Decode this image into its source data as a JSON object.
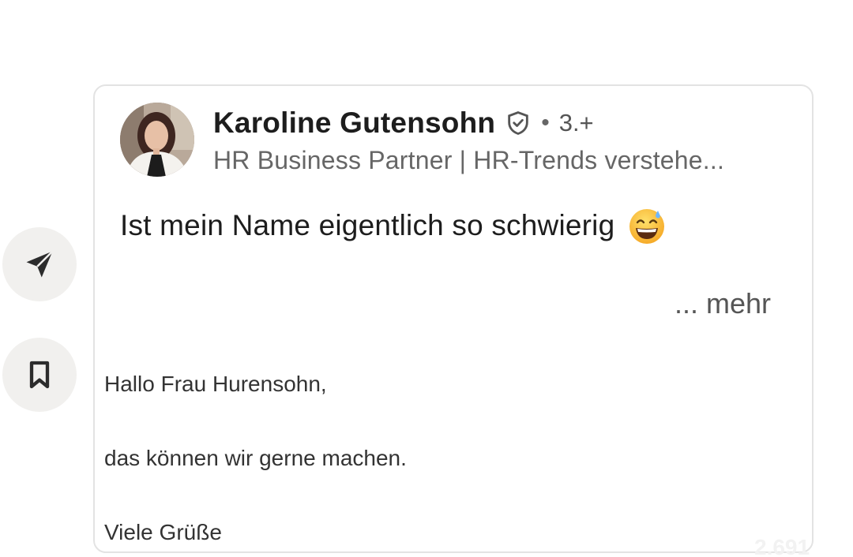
{
  "post": {
    "author": {
      "name": "Karoline Gutensohn",
      "connection_degree": "3.+",
      "headline": "HR Business Partner | HR-Trends verstehe..."
    },
    "text": "Ist mein Name eigentlich so schwierig",
    "more_label": "... mehr",
    "icons": {
      "verified": "shield-check-icon",
      "emoji": "grinning-face-with-sweat-emoji"
    }
  },
  "reply": {
    "greeting": "Hallo Frau Hurensohn,",
    "body": "das können wir gerne machen.",
    "closing": "Viele Grüße"
  },
  "side_actions": [
    {
      "name": "send",
      "icon": "send-icon"
    },
    {
      "name": "save",
      "icon": "bookmark-icon"
    }
  ],
  "overlay": {
    "count": "2.691"
  }
}
